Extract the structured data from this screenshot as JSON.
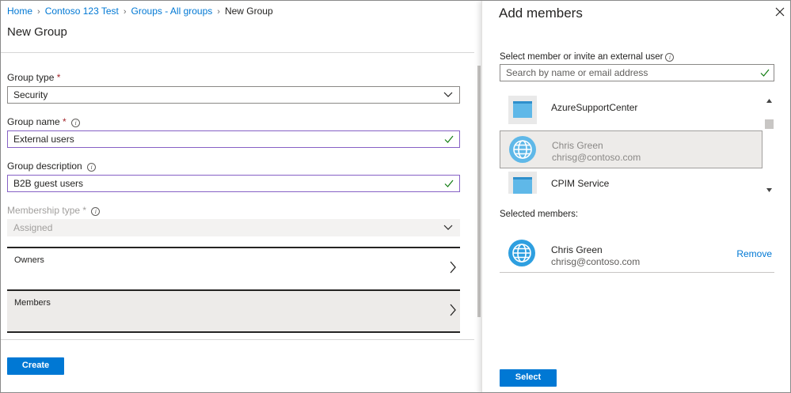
{
  "breadcrumb": [
    "Home",
    "Contoso 123 Test",
    "Groups - All groups",
    "New Group"
  ],
  "page_title": "New Group",
  "form": {
    "group_type": {
      "label": "Group type",
      "required_mark": "*",
      "value": "Security"
    },
    "group_name": {
      "label": "Group name",
      "required_mark": "*",
      "value": "External users"
    },
    "group_description": {
      "label": "Group description",
      "value": "B2B guest users"
    },
    "membership_type": {
      "label": "Membership type",
      "required_mark": "*",
      "value": "Assigned"
    },
    "owners_label": "Owners",
    "members_label": "Members",
    "create_label": "Create"
  },
  "panel": {
    "title": "Add members",
    "search_label": "Select member or invite an external user",
    "search_placeholder": "Search by name or email address",
    "results": [
      {
        "name": "AzureSupportCenter",
        "email": "",
        "icon": "app-icon",
        "selected": false
      },
      {
        "name": "Chris Green",
        "email": "chrisg@contoso.com",
        "icon": "globe-icon",
        "selected": true
      },
      {
        "name": "CPIM Service",
        "email": "",
        "icon": "app-icon",
        "selected": false
      }
    ],
    "selected_label": "Selected members:",
    "selected_members": [
      {
        "name": "Chris Green",
        "email": "chrisg@contoso.com",
        "remove_label": "Remove"
      }
    ],
    "select_label": "Select"
  },
  "colors": {
    "accent": "#0078d4",
    "valid_check": "#107c10",
    "focus_border": "#8661c5",
    "required": "#a4262c"
  }
}
